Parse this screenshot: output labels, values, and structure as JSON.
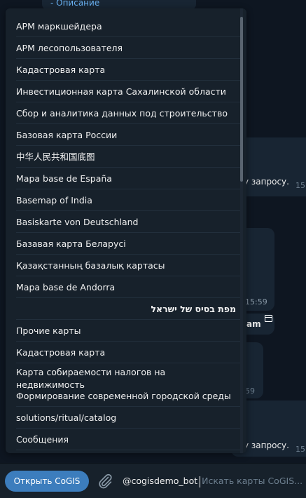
{
  "background_chat": {
    "top_link": "- Описание",
    "text_1": "у запросу.",
    "time_1": "15",
    "time_2": "15:59",
    "text_2": "am",
    "time_3": "59",
    "text_3": "у запросу.",
    "time_4": "15"
  },
  "menu": {
    "items": [
      {
        "label": "АРМ маркшейдера"
      },
      {
        "label": "АРМ лесопользователя"
      },
      {
        "label": "Кадастровая карта"
      },
      {
        "label": "Инвестиционная карта Сахалинской области"
      },
      {
        "label": "Сбор и аналитика данных под строительство"
      },
      {
        "label": "Базовая карта России"
      },
      {
        "label": "中华人民共和国底图"
      },
      {
        "label": "Mapa base de España"
      },
      {
        "label": "Basemap of India"
      },
      {
        "label": "Basiskarte von Deutschland"
      },
      {
        "label": "Базавая карта Беларусі"
      },
      {
        "label": "Қазақстанның базалық картасы"
      },
      {
        "label": "Mapa base de Andorra"
      },
      {
        "label": "מפת בסיס של ישראל"
      },
      {
        "label": "Прочие карты"
      },
      {
        "label": "Кадастровая карта"
      },
      {
        "label": "Карта собираемости налогов на недвижимость"
      },
      {
        "label": "Формирование современной городской среды"
      },
      {
        "label": "solutions/ritual/catalog"
      },
      {
        "label": "Сообщения"
      }
    ]
  },
  "bottombar": {
    "open_button": "Открыть CoGIS",
    "input_value": "@cogisdemo_bot",
    "input_placeholder": "Искать карты CoGIS..."
  },
  "colors": {
    "accent": "#3c7dbd",
    "menu_bg": "#17212b",
    "chat_bg": "#0e1621"
  }
}
